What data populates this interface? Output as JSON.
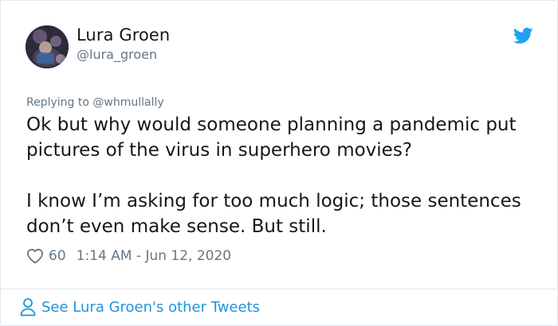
{
  "author": {
    "name": "Lura Groen",
    "handle": "@lura_groen"
  },
  "tweet": {
    "replying_prefix": "Replying to ",
    "replying_to": "@whmullally",
    "paragraphs": [
      "Ok but why would someone planning a pandemic put pictures of the virus in superhero movies?",
      "I know I’m asking for too much logic; those sentences don’t even make sense. But still."
    ],
    "likes": "60",
    "timestamp": "1:14 AM - Jun 12, 2020"
  },
  "footer": {
    "link_label": "See Lura Groen's other Tweets"
  },
  "icons": {
    "brand": "twitter-bird-icon",
    "like": "heart-outline-icon",
    "profile": "person-outline-icon"
  },
  "colors": {
    "brand_blue": "#1da1f2",
    "link_blue": "#1b95e0",
    "muted": "#657786",
    "text": "#14171a",
    "border": "#e1e8ed"
  }
}
